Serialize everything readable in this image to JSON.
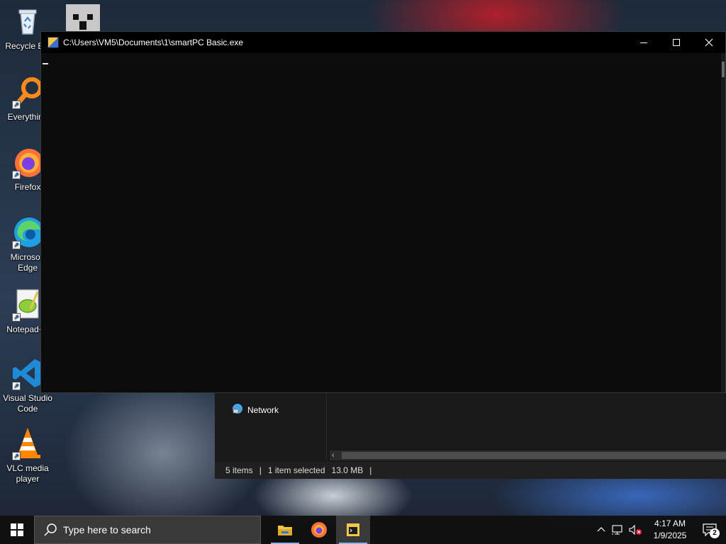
{
  "desktop": {
    "icons": [
      {
        "label": "Recycle Bin",
        "icon": "recycle-bin-icon"
      },
      {
        "label": "Everything",
        "icon": "everything-search-icon"
      },
      {
        "label": "Firefox",
        "icon": "firefox-icon"
      },
      {
        "label": "Microsoft Edge",
        "icon": "edge-icon"
      },
      {
        "label": "Notepad++",
        "icon": "notepad-plus-plus-icon"
      },
      {
        "label": "Visual Studio Code",
        "icon": "vscode-icon"
      },
      {
        "label": "VLC media player",
        "icon": "vlc-icon"
      }
    ],
    "top_icon": "creeper-icon"
  },
  "console_window": {
    "title": "C:\\Users\\VM5\\Documents\\1\\smartPC Basic.exe",
    "minimize_glyph": "—",
    "maximize_glyph": "☐",
    "close_glyph": "✕",
    "background": "#0c0c0c"
  },
  "explorer": {
    "nav_network_label": "Network",
    "status_items": "5 items",
    "status_selected": "1 item selected",
    "status_size": "13.0 MB",
    "sep": "|"
  },
  "taskbar": {
    "search_placeholder": "Type here to search",
    "clock_time": "4:17 AM",
    "clock_date": "1/9/2025",
    "notification_count": "2",
    "apps": [
      "file-explorer-icon",
      "firefox-icon",
      "smartpc-console-icon"
    ],
    "accent": "#8cb4e8"
  }
}
